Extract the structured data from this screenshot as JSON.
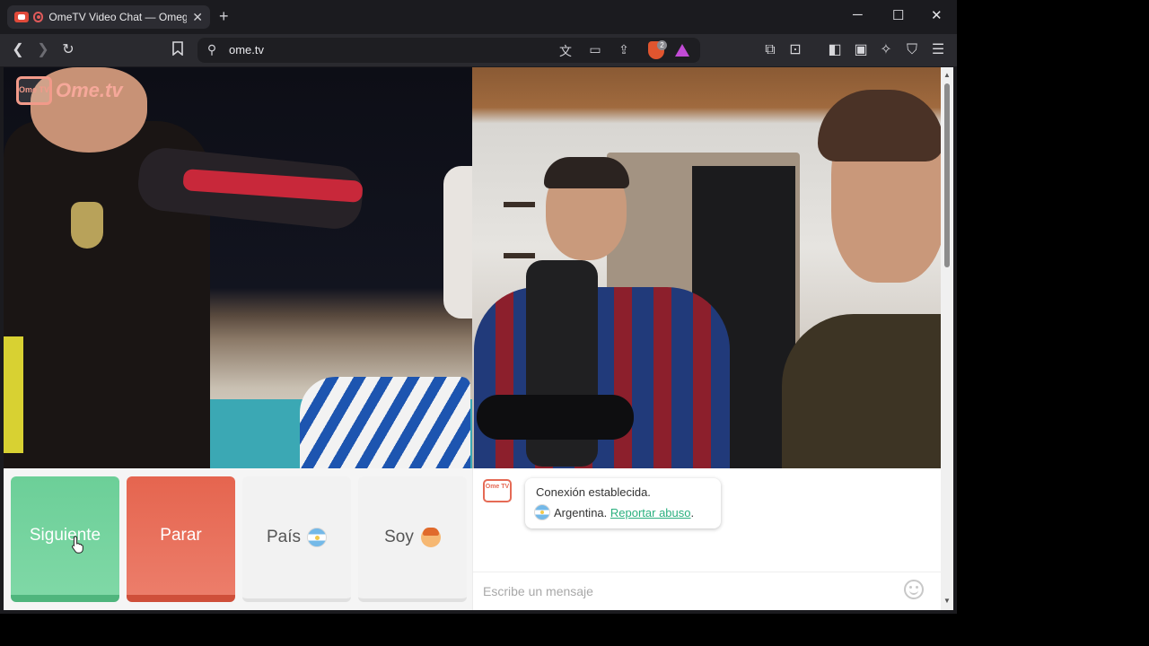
{
  "browser": {
    "tab_title": "OmeTV Video Chat — Omegle",
    "tab_close": "✕",
    "new_tab": "+",
    "window_controls": {
      "minimize": "─",
      "maximize": "☐",
      "close": "✕"
    },
    "url": "ome.tv",
    "extension_badge": "2"
  },
  "site": {
    "logo_text": "Ome.tv",
    "logo_badge": "Ome TV"
  },
  "controls": {
    "next_label": "Siguiente",
    "stop_label": "Parar",
    "country_label": "País",
    "iam_label": "Soy"
  },
  "chat": {
    "logo_badge": "Ome TV",
    "status": "Conexión establecida.",
    "country": "Argentina.",
    "report_link": "Reportar abuso",
    "report_suffix": ".",
    "input_placeholder": "Escribe un mensaje"
  },
  "colors": {
    "next": "#6ccf98",
    "stop": "#e5654f",
    "link": "#2bb07f",
    "brand": "#e56a55"
  }
}
